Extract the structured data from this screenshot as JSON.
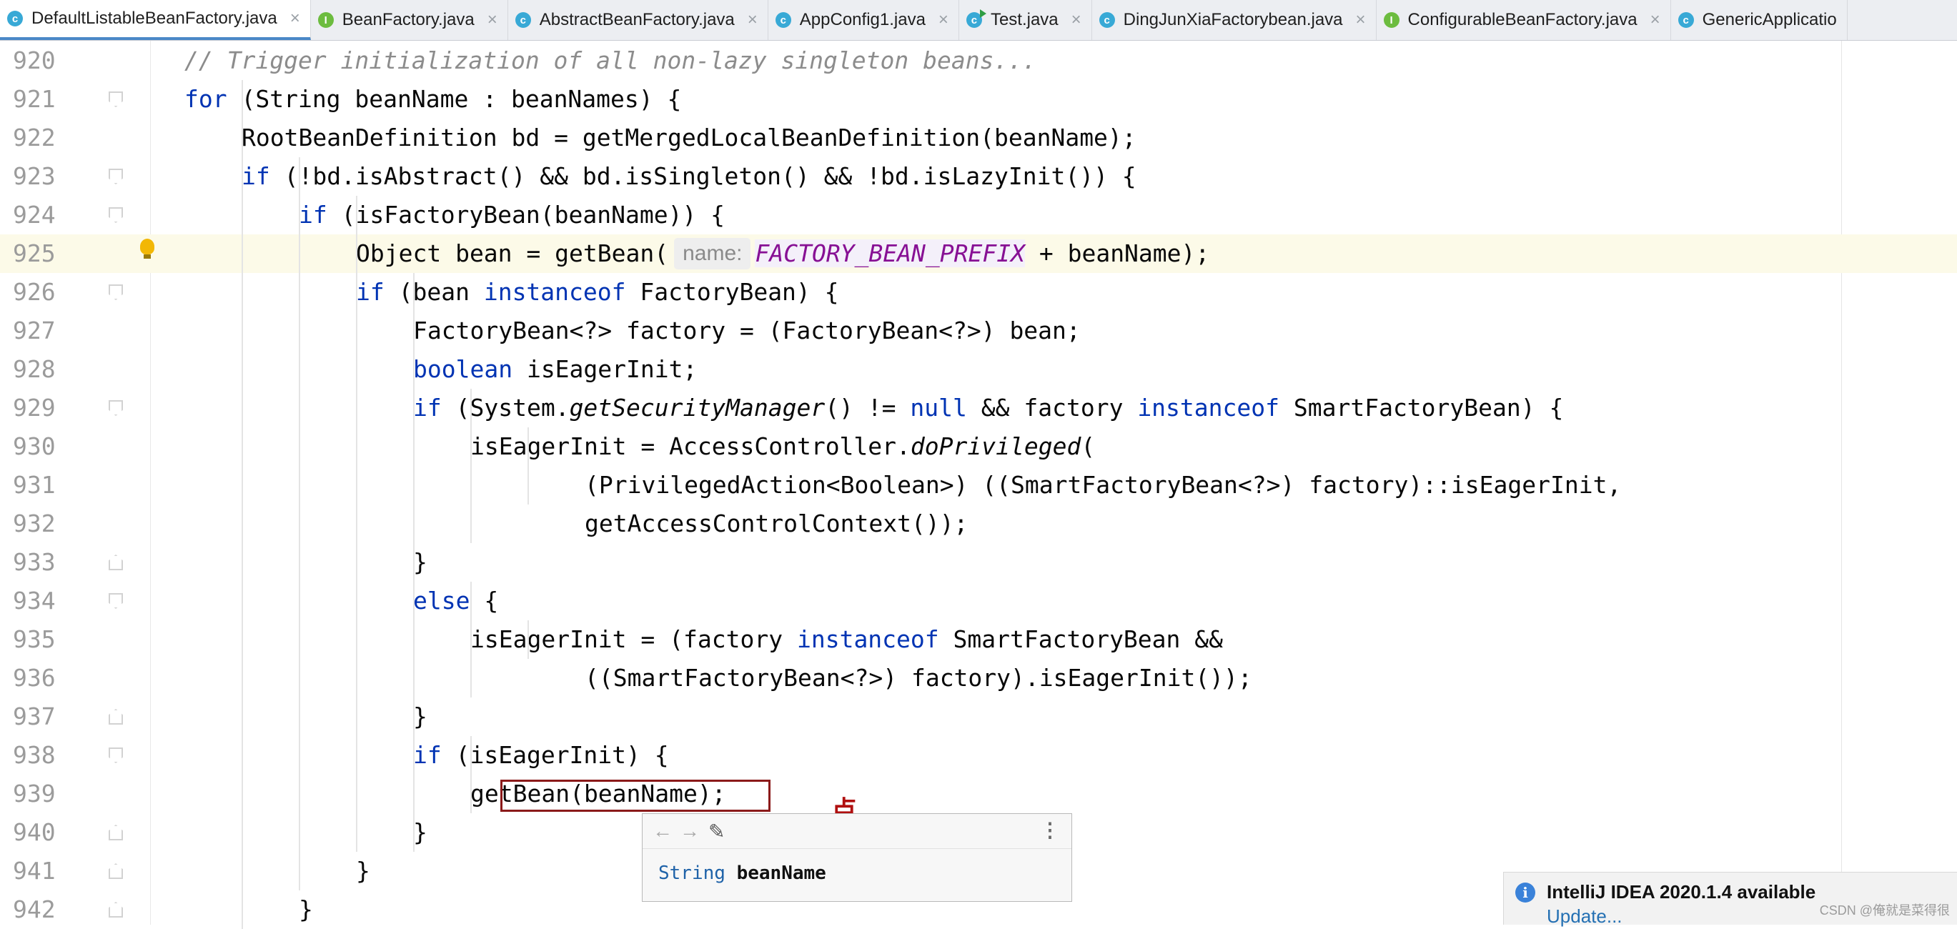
{
  "tabs": [
    {
      "label": "DefaultListableBeanFactory.java",
      "icon": "class-icon",
      "active": true
    },
    {
      "label": "BeanFactory.java",
      "icon": "interface-icon",
      "active": false
    },
    {
      "label": "AbstractBeanFactory.java",
      "icon": "class-icon",
      "active": false
    },
    {
      "label": "AppConfig1.java",
      "icon": "class-icon",
      "active": false
    },
    {
      "label": "Test.java",
      "icon": "runnable-class-icon",
      "active": false
    },
    {
      "label": "DingJunXiaFactorybean.java",
      "icon": "class-icon",
      "active": false
    },
    {
      "label": "ConfigurableBeanFactory.java",
      "icon": "interface-icon",
      "active": false
    },
    {
      "label": "GenericApplicatio",
      "icon": "class-icon",
      "active": false
    }
  ],
  "lines": [
    {
      "n": "920",
      "indent": 1,
      "fold": "",
      "segs": [
        [
          "cm",
          "// Trigger initialization of all non-lazy singleton beans..."
        ]
      ]
    },
    {
      "n": "921",
      "indent": 1,
      "fold": "open",
      "segs": [
        [
          "kw",
          "for"
        ],
        [
          "",
          " (String beanName : beanNames) {"
        ]
      ]
    },
    {
      "n": "922",
      "indent": 2,
      "fold": "",
      "segs": [
        [
          "",
          "RootBeanDefinition bd = getMergedLocalBeanDefinition(beanName);"
        ]
      ]
    },
    {
      "n": "923",
      "indent": 2,
      "fold": "open",
      "segs": [
        [
          "kw",
          "if"
        ],
        [
          "",
          " (!bd.isAbstract() && bd.isSingleton() && !bd.isLazyInit()) {"
        ]
      ]
    },
    {
      "n": "924",
      "indent": 3,
      "fold": "open",
      "segs": [
        [
          "kw",
          "if"
        ],
        [
          "",
          " (isFactoryBean(beanName)) {"
        ]
      ]
    },
    {
      "n": "925",
      "indent": 4,
      "fold": "",
      "highlight": true,
      "segs": [
        [
          "",
          "Object bean = getBean("
        ],
        [
          "hint",
          "name:"
        ],
        [
          "cst",
          "FACTORY_BEAN_PREFIX"
        ],
        [
          "",
          " + beanName);"
        ]
      ]
    },
    {
      "n": "926",
      "indent": 4,
      "fold": "open",
      "segs": [
        [
          "kw",
          "if"
        ],
        [
          "",
          " (bean "
        ],
        [
          "kw",
          "instanceof"
        ],
        [
          "",
          " FactoryBean) {"
        ]
      ]
    },
    {
      "n": "927",
      "indent": 5,
      "fold": "",
      "segs": [
        [
          "",
          "FactoryBean<?> factory = (FactoryBean<?>) bean;"
        ]
      ]
    },
    {
      "n": "928",
      "indent": 5,
      "fold": "",
      "segs": [
        [
          "kw",
          "boolean"
        ],
        [
          "",
          " isEagerInit;"
        ]
      ]
    },
    {
      "n": "929",
      "indent": 5,
      "fold": "open",
      "segs": [
        [
          "kw",
          "if"
        ],
        [
          "",
          " (System."
        ],
        [
          "it",
          "getSecurityManager"
        ],
        [
          "",
          "() != "
        ],
        [
          "kw",
          "null"
        ],
        [
          "",
          " && factory "
        ],
        [
          "kw",
          "instanceof"
        ],
        [
          "",
          " SmartFactoryBean) {"
        ]
      ]
    },
    {
      "n": "930",
      "indent": 6,
      "fold": "",
      "segs": [
        [
          "",
          "isEagerInit = AccessController."
        ],
        [
          "it",
          "doPrivileged"
        ],
        [
          "",
          "("
        ]
      ]
    },
    {
      "n": "931",
      "indent": 8,
      "fold": "",
      "segs": [
        [
          "",
          "(PrivilegedAction<Boolean>) ((SmartFactoryBean<?>) factory)::isEagerInit,"
        ]
      ]
    },
    {
      "n": "932",
      "indent": 8,
      "fold": "",
      "segs": [
        [
          "",
          "getAccessControlContext());"
        ]
      ]
    },
    {
      "n": "933",
      "indent": 5,
      "fold": "close",
      "segs": [
        [
          "",
          "}"
        ]
      ]
    },
    {
      "n": "934",
      "indent": 5,
      "fold": "open",
      "segs": [
        [
          "kw",
          "else"
        ],
        [
          "",
          " {"
        ]
      ]
    },
    {
      "n": "935",
      "indent": 6,
      "fold": "",
      "segs": [
        [
          "",
          "isEagerInit = (factory "
        ],
        [
          "kw",
          "instanceof"
        ],
        [
          "",
          " SmartFactoryBean &&"
        ]
      ]
    },
    {
      "n": "936",
      "indent": 8,
      "fold": "",
      "segs": [
        [
          "",
          "((SmartFactoryBean<?>) factory).isEagerInit());"
        ]
      ]
    },
    {
      "n": "937",
      "indent": 5,
      "fold": "close",
      "segs": [
        [
          "",
          "}"
        ]
      ]
    },
    {
      "n": "938",
      "indent": 5,
      "fold": "open",
      "segs": [
        [
          "kw",
          "if"
        ],
        [
          "",
          " (isEagerInit) {"
        ]
      ]
    },
    {
      "n": "939",
      "indent": 6,
      "fold": "",
      "segs": [
        [
          "",
          "getBean(beanName);"
        ]
      ]
    },
    {
      "n": "940",
      "indent": 5,
      "fold": "close",
      "segs": [
        [
          "",
          "}"
        ]
      ]
    },
    {
      "n": "941",
      "indent": 4,
      "fold": "close",
      "segs": [
        [
          "",
          "}"
        ]
      ]
    },
    {
      "n": "942",
      "indent": 3,
      "fold": "close",
      "segs": [
        [
          "",
          "}"
        ]
      ]
    }
  ],
  "annotation": {
    "text": "点"
  },
  "doc_popup": {
    "type": "String",
    "name": "beanName"
  },
  "notification": {
    "title": "IntelliJ IDEA 2020.1.4 available",
    "link": "Update..."
  },
  "watermark": "CSDN @俺就是菜得很"
}
